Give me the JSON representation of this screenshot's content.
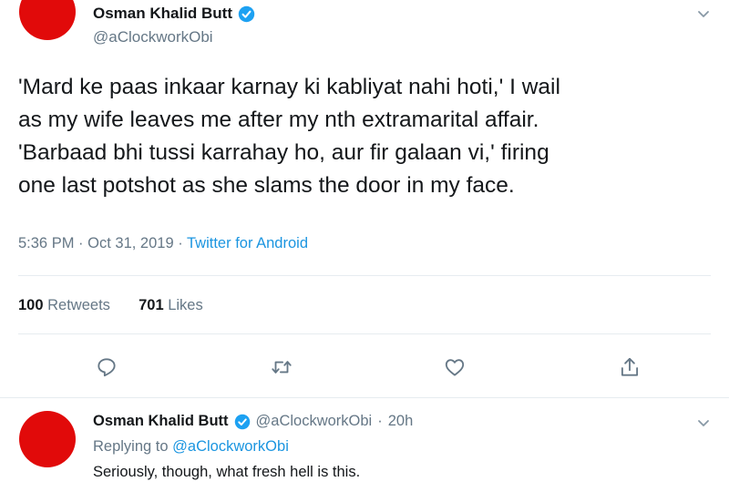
{
  "colors": {
    "avatar": "#e10a0a",
    "verified": "#1da1f2",
    "link": "#1b95e0",
    "secondary_text": "#657786",
    "divider": "#e6ecf0"
  },
  "main_tweet": {
    "author": {
      "name": "Osman Khalid Butt",
      "handle": "@aClockworkObi"
    },
    "text_lines": [
      "'Mard ke paas inkaar karnay ki kabliyat nahi hoti,' I wail",
      "as my wife leaves me after my nth extramarital affair.",
      "'Barbaad bhi tussi karrahay ho, aur fir galaan vi,' firing",
      "one last potshot as she slams the door in my face."
    ],
    "time": "5:36 PM",
    "date": "Oct 31, 2019",
    "separator": "·",
    "source": "Twitter for Android",
    "stats": {
      "retweets_count": "100",
      "retweets_label": "Retweets",
      "likes_count": "701",
      "likes_label": "Likes"
    },
    "actions": [
      "reply-icon",
      "retweet-icon",
      "like-icon",
      "share-icon"
    ]
  },
  "reply_tweet": {
    "author": {
      "name": "Osman Khalid Butt",
      "handle": "@aClockworkObi"
    },
    "separator": "·",
    "age": "20h",
    "replying_prefix": "Replying to",
    "replying_to": "@aClockworkObi",
    "text": "Seriously, though, what fresh hell is this."
  }
}
